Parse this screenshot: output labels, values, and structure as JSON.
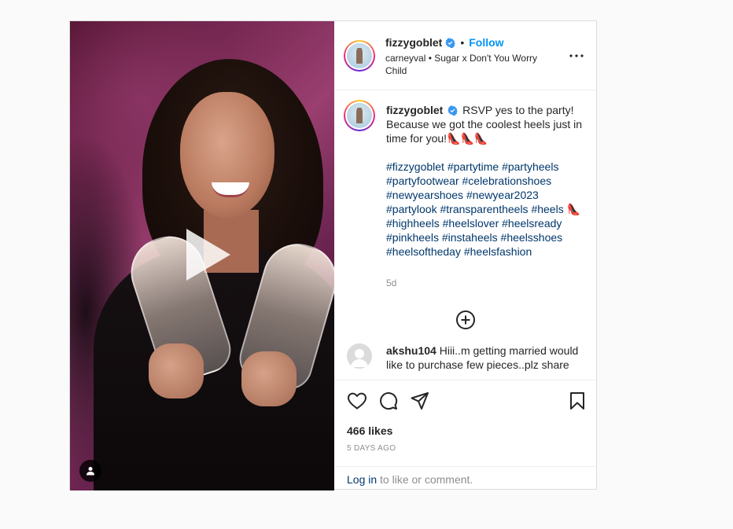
{
  "header": {
    "username": "fizzygoblet",
    "separator": "•",
    "follow_label": "Follow",
    "audio_artist": "carneyval",
    "audio_sep": "•",
    "audio_title": "Sugar x Don't You Worry Child"
  },
  "caption": {
    "username": "fizzygoblet",
    "text": "RSVP yes to the party! Because we got the coolest heels just in time for you!👠👠👠",
    "hashtags_line1": "#fizzygoblet",
    "hashtags": [
      "#fizzygoblet",
      "#partytime",
      "#partyheels",
      "#partyfootwear",
      "#celebrationshoes",
      "#newyearshoes",
      "#newyear2023",
      "#partylook",
      "#transparentheels",
      "#heels",
      "#highheels",
      "#heelslover",
      "#heelsready",
      "#pinkheels",
      "#instaheels",
      "#heelsshoes",
      "#heelsoftheday",
      "#heelsfashion"
    ],
    "heel_emoji": "👠",
    "time": "5d"
  },
  "comment": {
    "username": "akshu104",
    "text": "Hiii..m getting married would like to purchase few pieces..plz share"
  },
  "likes": "466 likes",
  "posted_ago": "5 DAYS AGO",
  "login": {
    "link": "Log in",
    "rest": " to like or comment."
  },
  "colors": {
    "follow": "#0095f6",
    "hashtag": "#00376b",
    "muted": "#8e8e8e",
    "verified": "#3897f0"
  },
  "icons": [
    "play-icon",
    "user-tag-icon",
    "verified-icon",
    "more-icon",
    "add-comment-icon",
    "heart-icon",
    "comment-icon",
    "share-icon",
    "bookmark-icon"
  ]
}
